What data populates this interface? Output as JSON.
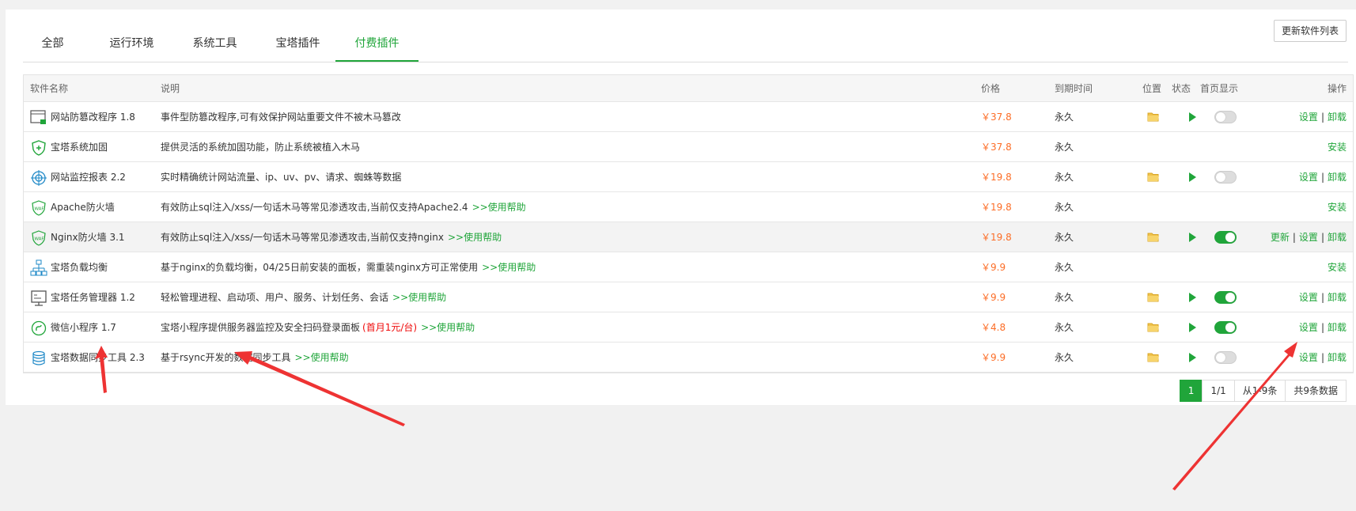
{
  "tabs": [
    {
      "label": "全部",
      "active": false
    },
    {
      "label": "运行环境",
      "active": false
    },
    {
      "label": "系统工具",
      "active": false
    },
    {
      "label": "宝塔插件",
      "active": false
    },
    {
      "label": "付费插件",
      "active": true
    }
  ],
  "update_button": "更新软件列表",
  "columns": {
    "name": "软件名称",
    "desc": "说明",
    "price": "价格",
    "expire": "到期时间",
    "position": "位置",
    "state": "状态",
    "home": "首页显示",
    "ops": "操作"
  },
  "rows": [
    {
      "name": "网站防篡改程序 1.8",
      "icon": "tamper-proof-icon",
      "desc": "事件型防篡改程序,可有效保护网站重要文件不被木马篡改",
      "help": "",
      "promo": "",
      "price": "￥37.8",
      "expire": "永久",
      "folder": true,
      "play": true,
      "home": "off",
      "ops": [
        "设置",
        "卸载"
      ]
    },
    {
      "name": "宝塔系统加固",
      "icon": "shield-icon",
      "desc": "提供灵活的系统加固功能，防止系统被植入木马",
      "help": "",
      "promo": "",
      "price": "￥37.8",
      "expire": "永久",
      "folder": false,
      "play": false,
      "home": "none",
      "ops": [
        "安装"
      ]
    },
    {
      "name": "网站监控报表 2.2",
      "icon": "monitor-target-icon",
      "desc": "实时精确统计网站流量、ip、uv、pv、请求、蜘蛛等数据",
      "help": "",
      "promo": "",
      "price": "￥19.8",
      "expire": "永久",
      "folder": true,
      "play": true,
      "home": "off",
      "ops": [
        "设置",
        "卸载"
      ]
    },
    {
      "name": "Apache防火墙",
      "icon": "waf-icon",
      "desc": "有效防止sql注入/xss/一句话木马等常见渗透攻击,当前仅支持Apache2.4",
      "help": ">>使用帮助",
      "promo": "",
      "price": "￥19.8",
      "expire": "永久",
      "folder": false,
      "play": false,
      "home": "none",
      "ops": [
        "安装"
      ]
    },
    {
      "name": "Nginx防火墙 3.1",
      "icon": "waf-icon",
      "desc": "有效防止sql注入/xss/一句话木马等常见渗透攻击,当前仅支持nginx",
      "help": ">>使用帮助",
      "promo": "",
      "price": "￥19.8",
      "expire": "永久",
      "folder": true,
      "play": true,
      "home": "on",
      "ops": [
        "更新",
        "设置",
        "卸载"
      ]
    },
    {
      "name": "宝塔负载均衡",
      "icon": "load-balance-icon",
      "desc": "基于nginx的负载均衡，04/25日前安装的面板，需重装nginx方可正常使用",
      "help": ">>使用帮助",
      "promo": "",
      "price": "￥9.9",
      "expire": "永久",
      "folder": false,
      "play": false,
      "home": "none",
      "ops": [
        "安装"
      ]
    },
    {
      "name": "宝塔任务管理器 1.2",
      "icon": "task-manager-icon",
      "desc": "轻松管理进程、启动项、用户、服务、计划任务、会话",
      "help": ">>使用帮助",
      "promo": "",
      "price": "￥9.9",
      "expire": "永久",
      "folder": true,
      "play": true,
      "home": "on",
      "ops": [
        "设置",
        "卸载"
      ]
    },
    {
      "name": "微信小程序 1.7",
      "icon": "mini-program-icon",
      "desc": "宝塔小程序提供服务器监控及安全扫码登录面板",
      "help": ">>使用帮助",
      "promo": "(首月1元/台)",
      "price": "￥4.8",
      "expire": "永久",
      "folder": true,
      "play": true,
      "home": "on",
      "ops": [
        "设置",
        "卸载"
      ]
    },
    {
      "name": "宝塔数据同步工具 2.3",
      "icon": "database-sync-icon",
      "desc": "基于rsync开发的数据同步工具",
      "help": ">>使用帮助",
      "promo": "",
      "price": "￥9.9",
      "expire": "永久",
      "folder": true,
      "play": true,
      "home": "off",
      "ops": [
        "设置",
        "卸载"
      ]
    }
  ],
  "pager": {
    "current": "1",
    "pages": "1/1",
    "range": "从1-9条",
    "total": "共9条数据"
  },
  "colors": {
    "accent": "#20a53a",
    "price": "#fc6d26",
    "promo": "#ef0808",
    "annotation": "#ee3333"
  }
}
